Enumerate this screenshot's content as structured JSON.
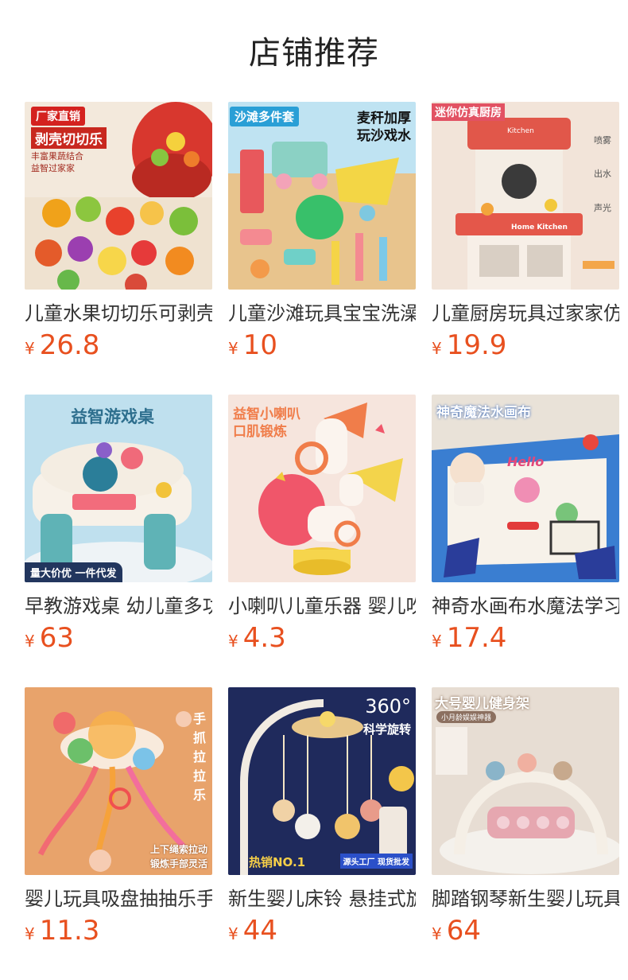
{
  "header": {
    "title": "店铺推荐"
  },
  "currency": "¥",
  "products": [
    {
      "name": "儿童水果切切乐可剥壳",
      "price": "26.8",
      "badge": "厂家直销",
      "overlay": [
        "剥壳切切乐",
        "丰富果蔬结合",
        "益智过家家"
      ]
    },
    {
      "name": "儿童沙滩玩具宝宝洗澡",
      "price": "10",
      "badge": "沙滩多件套",
      "overlay": [
        "麦秆加厚",
        "玩沙戏水"
      ]
    },
    {
      "name": "儿童厨房玩具过家家仿真",
      "price": "19.9",
      "badge": "迷你仿真厨房",
      "overlay": [
        "喷雾",
        "出水",
        "声光",
        "Kitchen",
        "Home Kitchen"
      ]
    },
    {
      "name": "早教游戏桌 幼儿童多功能",
      "price": "63",
      "badge": "量大价优 一件代发",
      "overlay": [
        "益智游戏桌"
      ]
    },
    {
      "name": "小喇叭儿童乐器 婴儿吹",
      "price": "4.3",
      "badge": "",
      "overlay": [
        "益智小喇叭",
        "口肌锻炼"
      ]
    },
    {
      "name": "神奇水画布水魔法学习",
      "price": "17.4",
      "badge": "神奇魔法水画布",
      "overlay": [
        "Hello"
      ]
    },
    {
      "name": "婴儿玩具吸盘抽抽乐手指",
      "price": "11.3",
      "badge": "",
      "overlay": [
        "手",
        "抓",
        "拉",
        "拉",
        "乐",
        "上下绳索拉动",
        "锻炼手部灵活"
      ]
    },
    {
      "name": "新生婴儿床铃 悬挂式旋转",
      "price": "44",
      "badge": "热销NO.1",
      "overlay": [
        "360°",
        "科学旋转",
        "源头工厂 现货批发"
      ]
    },
    {
      "name": "脚踏钢琴新生婴儿玩具",
      "price": "64",
      "badge": "大号婴儿健身架",
      "overlay": [
        "小月龄娱娱神器"
      ]
    }
  ]
}
